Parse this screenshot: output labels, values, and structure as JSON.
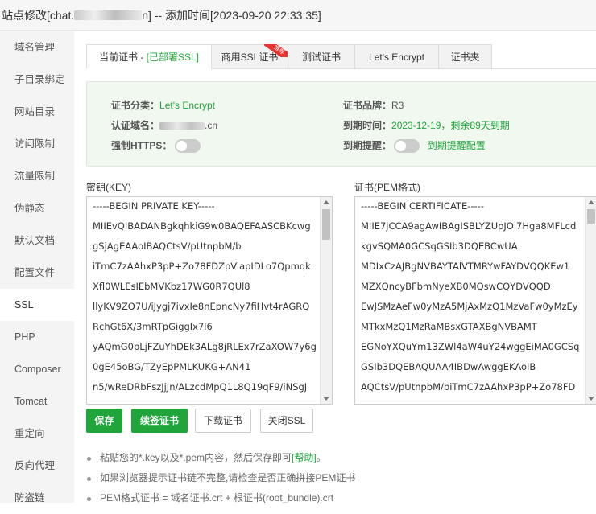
{
  "titlebar": {
    "prefix": "站点修改[chat.",
    "suffix": "n] -- 添加时间[2023-09-20 22:33:35]"
  },
  "sidebar": {
    "items": [
      "域名管理",
      "子目录绑定",
      "网站目录",
      "访问限制",
      "流量限制",
      "伪静态",
      "默认文档",
      "配置文件",
      "SSL",
      "PHP",
      "Composer",
      "Tomcat",
      "重定向",
      "反向代理",
      "防盗链"
    ],
    "active": "SSL"
  },
  "tabs": {
    "current_prefix": "当前证书 - ",
    "current_status": "[已部署SSL]",
    "commercial": "商用SSL证书",
    "recommend_badge": "推荐",
    "test": "测试证书",
    "letsencrypt": "Let's Encrypt",
    "folder": "证书夹"
  },
  "info": {
    "category_label": "证书分类：",
    "category_value": "Let's Encrypt",
    "brand_label": "证书品牌：",
    "brand_value": "R3",
    "domain_label": "认证域名：",
    "domain_suffix": ".cn",
    "expire_label": "到期时间：",
    "expire_value": "2023-12-19，剩余89天到期",
    "https_label": "强制HTTPS：",
    "remind_label": "到期提醒：",
    "remind_config": "到期提醒配置"
  },
  "key": {
    "label": "密钥(KEY)",
    "lines": [
      "-----BEGIN PRIVATE KEY-----",
      "MIIEvQIBADANBgkqhkiG9w0BAQEFAASCBKcwg",
      "gSjAgEAAoIBAQCtsV/pUtnpbM/b",
      "iTmC7zAAhxP3pP+Zo78FDZpViapIDLo7Qpmqk",
      "Xfl0WLEsIEbMVKbz17WG0R7QUl8",
      "llyKV9ZO7U/iJygj7ivxIe8nEpncNy7fiHvt4rAGRQ",
      "RchGt6X/3mRTpGiggIx7l6",
      "yAQmG0pLjFZuYhDEk3ALg8jRLEx7rZaXOW7y6g",
      "0gE45oBG/TZyEpPMLKUKG+AN41",
      "n5/wReDRbFszJjJn/ALzcdMpQ1L8Q19qF9/iNSgJ"
    ]
  },
  "cert": {
    "label": "证书(PEM格式)",
    "lines": [
      "-----BEGIN CERTIFICATE-----",
      "MIIE7jCCA9agAwIBAgISBLYZUpJOi7Hga8MFLcd",
      "kgvSQMA0GCSqGSIb3DQEBCwUA",
      "MDIxCzAJBgNVBAYTAlVTMRYwFAYDVQQKEw1",
      "MZXQncyBFbmNyeXB0MQswCQYDVQQD",
      "EwJSMzAeFw0yMzA5MjAxMzQ1MzVaFw0yMzEy",
      "MTkxMzQ1MzRaMBsxGTAXBgNVBAMT",
      "EGNoYXQuYm13ZWl4aW4uY24wggEiMA0GCSq",
      "GSIb3DQEBAQUAA4IBDwAwggEKAoIB",
      "AQCtsV/pUtnpbM/biTmC7zAAhxP3pP+Zo78FD"
    ]
  },
  "buttons": {
    "save": "保存",
    "renew": "续签证书",
    "download": "下载证书",
    "close": "关闭SSL"
  },
  "tips": {
    "tip1_text": "粘贴您的*.key以及*.pem内容，然后保存即可",
    "tip1_link": "[帮助]",
    "tip1_end": "。",
    "tip2": "如果浏览器提示证书链不完整,请检查是否正确拼接PEM证书",
    "tip3": "PEM格式证书 = 域名证书.crt + 根证书(root_bundle).crt"
  },
  "colors": {
    "accent": "#20a53a",
    "badge": "#e9322d"
  }
}
